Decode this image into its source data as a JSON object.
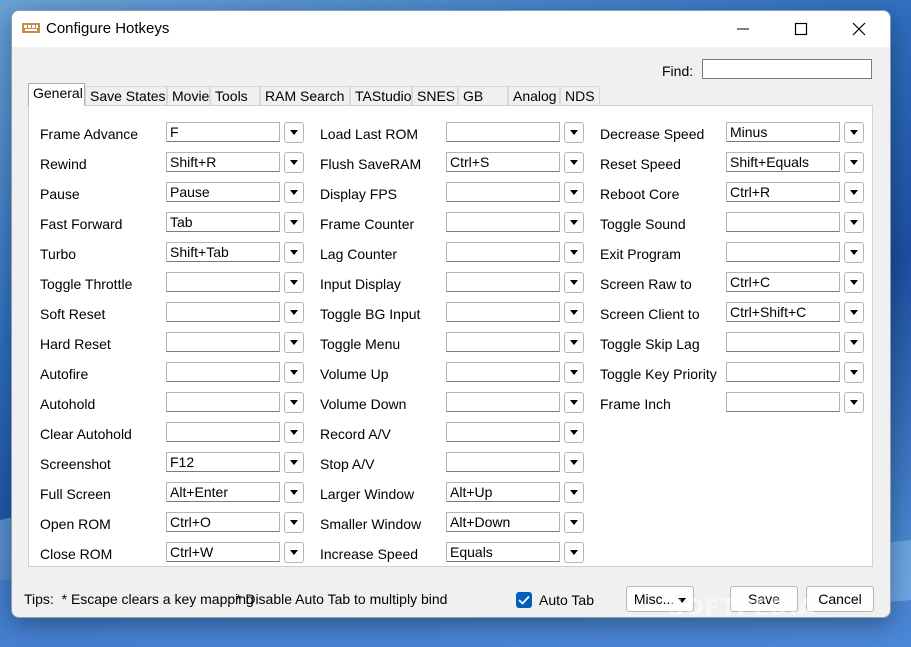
{
  "window": {
    "title": "Configure Hotkeys"
  },
  "find": {
    "label": "Find:",
    "value": ""
  },
  "tabs": [
    "General",
    "Save States",
    "Movie",
    "Tools",
    "RAM Search",
    "TAStudio",
    "SNES",
    "GB",
    "Analog",
    "NDS"
  ],
  "active_tab": "General",
  "columns": [
    [
      {
        "label": "Frame Advance",
        "value": "F"
      },
      {
        "label": "Rewind",
        "value": "Shift+R"
      },
      {
        "label": "Pause",
        "value": "Pause"
      },
      {
        "label": "Fast Forward",
        "value": "Tab"
      },
      {
        "label": "Turbo",
        "value": "Shift+Tab"
      },
      {
        "label": "Toggle Throttle",
        "value": ""
      },
      {
        "label": "Soft Reset",
        "value": ""
      },
      {
        "label": "Hard Reset",
        "value": ""
      },
      {
        "label": "Autofire",
        "value": ""
      },
      {
        "label": "Autohold",
        "value": ""
      },
      {
        "label": "Clear Autohold",
        "value": ""
      },
      {
        "label": "Screenshot",
        "value": "F12"
      },
      {
        "label": "Full Screen",
        "value": "Alt+Enter"
      },
      {
        "label": "Open ROM",
        "value": "Ctrl+O"
      },
      {
        "label": "Close ROM",
        "value": "Ctrl+W"
      }
    ],
    [
      {
        "label": "Load Last ROM",
        "value": ""
      },
      {
        "label": "Flush SaveRAM",
        "value": "Ctrl+S"
      },
      {
        "label": "Display FPS",
        "value": ""
      },
      {
        "label": "Frame Counter",
        "value": ""
      },
      {
        "label": "Lag Counter",
        "value": ""
      },
      {
        "label": "Input Display",
        "value": ""
      },
      {
        "label": "Toggle BG Input",
        "value": ""
      },
      {
        "label": "Toggle Menu",
        "value": ""
      },
      {
        "label": "Volume Up",
        "value": ""
      },
      {
        "label": "Volume Down",
        "value": ""
      },
      {
        "label": "Record A/V",
        "value": ""
      },
      {
        "label": "Stop A/V",
        "value": ""
      },
      {
        "label": "Larger Window",
        "value": "Alt+Up"
      },
      {
        "label": "Smaller Window",
        "value": "Alt+Down"
      },
      {
        "label": "Increase Speed",
        "value": "Equals"
      }
    ],
    [
      {
        "label": "Decrease Speed",
        "value": "Minus"
      },
      {
        "label": "Reset Speed",
        "value": "Shift+Equals"
      },
      {
        "label": "Reboot Core",
        "value": "Ctrl+R"
      },
      {
        "label": "Toggle Sound",
        "value": ""
      },
      {
        "label": "Exit Program",
        "value": ""
      },
      {
        "label": "Screen Raw to",
        "value": "Ctrl+C"
      },
      {
        "label": "Screen Client to",
        "value": "Ctrl+Shift+C"
      },
      {
        "label": "Toggle Skip Lag",
        "value": ""
      },
      {
        "label": "Toggle Key Priority",
        "value": ""
      },
      {
        "label": "Frame Inch",
        "value": ""
      }
    ]
  ],
  "tips": {
    "prefix": "Tips:",
    "tip1": "* Escape clears a key mapping",
    "tip2": "* Disable Auto Tab to multiply bind"
  },
  "auto_tab": {
    "label": "Auto Tab",
    "checked": true
  },
  "buttons": {
    "misc": "Misc...",
    "save": "Save",
    "cancel": "Cancel"
  },
  "watermark": "SOFTPEDIA",
  "colors": {
    "accent": "#005fb8",
    "window_bg": "#f0f0f0",
    "panel_bg": "#ffffff"
  }
}
